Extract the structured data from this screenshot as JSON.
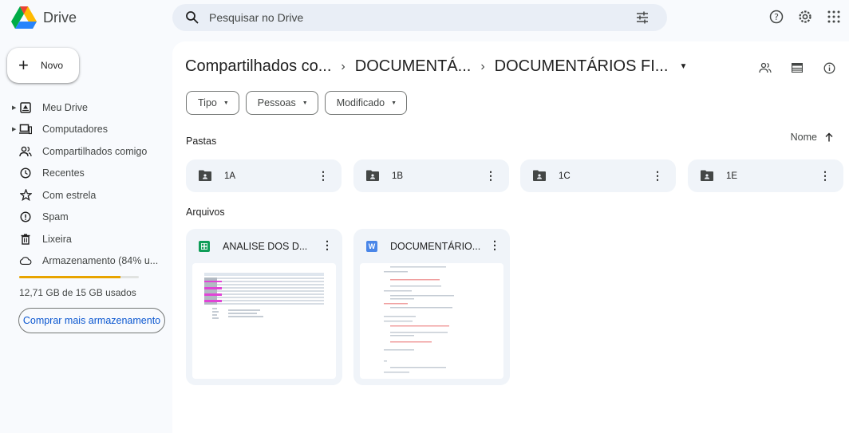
{
  "app": {
    "name": "Drive"
  },
  "search": {
    "placeholder": "Pesquisar no Drive"
  },
  "new_button": {
    "label": "Novo"
  },
  "sidebar": {
    "items": [
      {
        "label": "Meu Drive",
        "icon": "my-drive-icon",
        "expandable": true
      },
      {
        "label": "Computadores",
        "icon": "computer-icon",
        "expandable": true
      },
      {
        "label": "Compartilhados comigo",
        "icon": "shared-icon",
        "expandable": false
      },
      {
        "label": "Recentes",
        "icon": "clock-icon",
        "expandable": false
      },
      {
        "label": "Com estrela",
        "icon": "star-icon",
        "expandable": false
      },
      {
        "label": "Spam",
        "icon": "spam-icon",
        "expandable": false
      },
      {
        "label": "Lixeira",
        "icon": "trash-icon",
        "expandable": false
      },
      {
        "label": "Armazenamento (84% u...",
        "icon": "cloud-icon",
        "expandable": false
      }
    ],
    "storage": {
      "used_text": "12,71 GB de 15 GB usados",
      "used_fraction": 0.847,
      "bar_color": "#e8a400"
    },
    "buy_button": "Comprar mais armazenamento"
  },
  "breadcrumb": {
    "items": [
      "Compartilhados co...",
      "DOCUMENTÁ...",
      "DOCUMENTÁRIOS FI..."
    ],
    "separator": "›"
  },
  "filters": [
    "Tipo",
    "Pessoas",
    "Modificado"
  ],
  "sections": {
    "folders_title": "Pastas",
    "files_title": "Arquivos"
  },
  "sort": {
    "label": "Nome",
    "direction": "ascending"
  },
  "folders": [
    {
      "name": "1A"
    },
    {
      "name": "1B"
    },
    {
      "name": "1C"
    },
    {
      "name": "1E"
    }
  ],
  "files": [
    {
      "name": "ANALISE DOS D...",
      "type": "sheets",
      "icon_color": "#0f9d58",
      "icon_letter": ""
    },
    {
      "name": "DOCUMENTÁRIO...",
      "type": "word",
      "icon_color": "#4a86e8",
      "icon_letter": "W"
    }
  ],
  "colors": {
    "accent": "#0b57d0",
    "background": "#f8fafd",
    "card": "#f0f4f9"
  }
}
